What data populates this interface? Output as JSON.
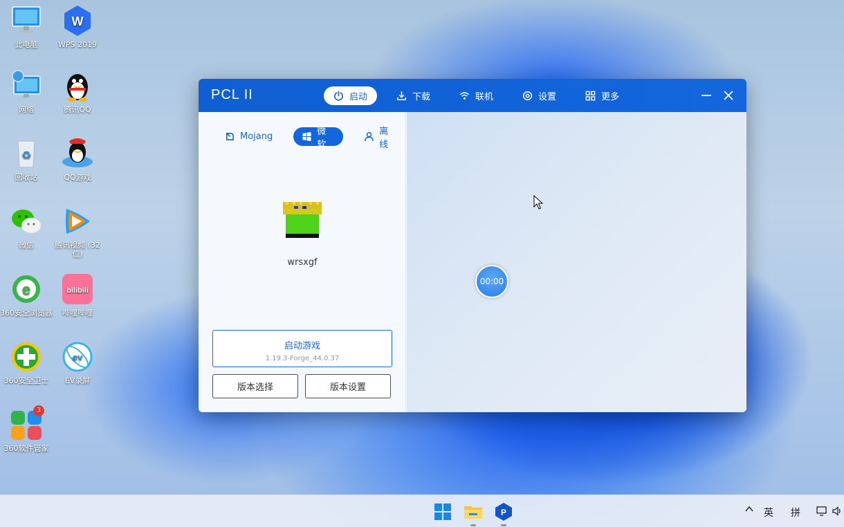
{
  "desktop": {
    "icons": [
      {
        "label": "此电脑"
      },
      {
        "label": "WPS 2019"
      },
      {
        "label": "网络"
      },
      {
        "label": "腾讯QQ"
      },
      {
        "label": "回收站"
      },
      {
        "label": "QQ游戏"
      },
      {
        "label": "微信"
      },
      {
        "label": "腾讯视频 (32位)"
      },
      {
        "label": "360安全浏览器"
      },
      {
        "label": "哔哩哔哩"
      },
      {
        "label": "360安全卫士"
      },
      {
        "label": "EV录屏"
      },
      {
        "label": "360软件管家",
        "badge": "3"
      }
    ]
  },
  "window": {
    "title": "PCL II",
    "nav": [
      {
        "label": "启动",
        "icon": "power-icon",
        "active": true
      },
      {
        "label": "下载",
        "icon": "download-icon"
      },
      {
        "label": "联机",
        "icon": "wifi-icon"
      },
      {
        "label": "设置",
        "icon": "gear-icon"
      },
      {
        "label": "更多",
        "icon": "grid-icon"
      }
    ]
  },
  "launch": {
    "account_tabs": [
      {
        "label": "Mojang",
        "icon": "mojang-icon"
      },
      {
        "label": "微软",
        "icon": "windows-icon",
        "active": true
      },
      {
        "label": "离线",
        "icon": "person-icon"
      }
    ],
    "username": "wrsxgf",
    "launch_label": "启动游戏",
    "version": "1.19.3-Forge_44.0.37",
    "version_select": "版本选择",
    "version_settings": "版本设置"
  },
  "timer": "00:00",
  "taskbar": {
    "ime_lang": "英",
    "ime_mode": "拼"
  },
  "colors": {
    "accent": "#1466dc",
    "title_bar": "#0f5fd3"
  }
}
